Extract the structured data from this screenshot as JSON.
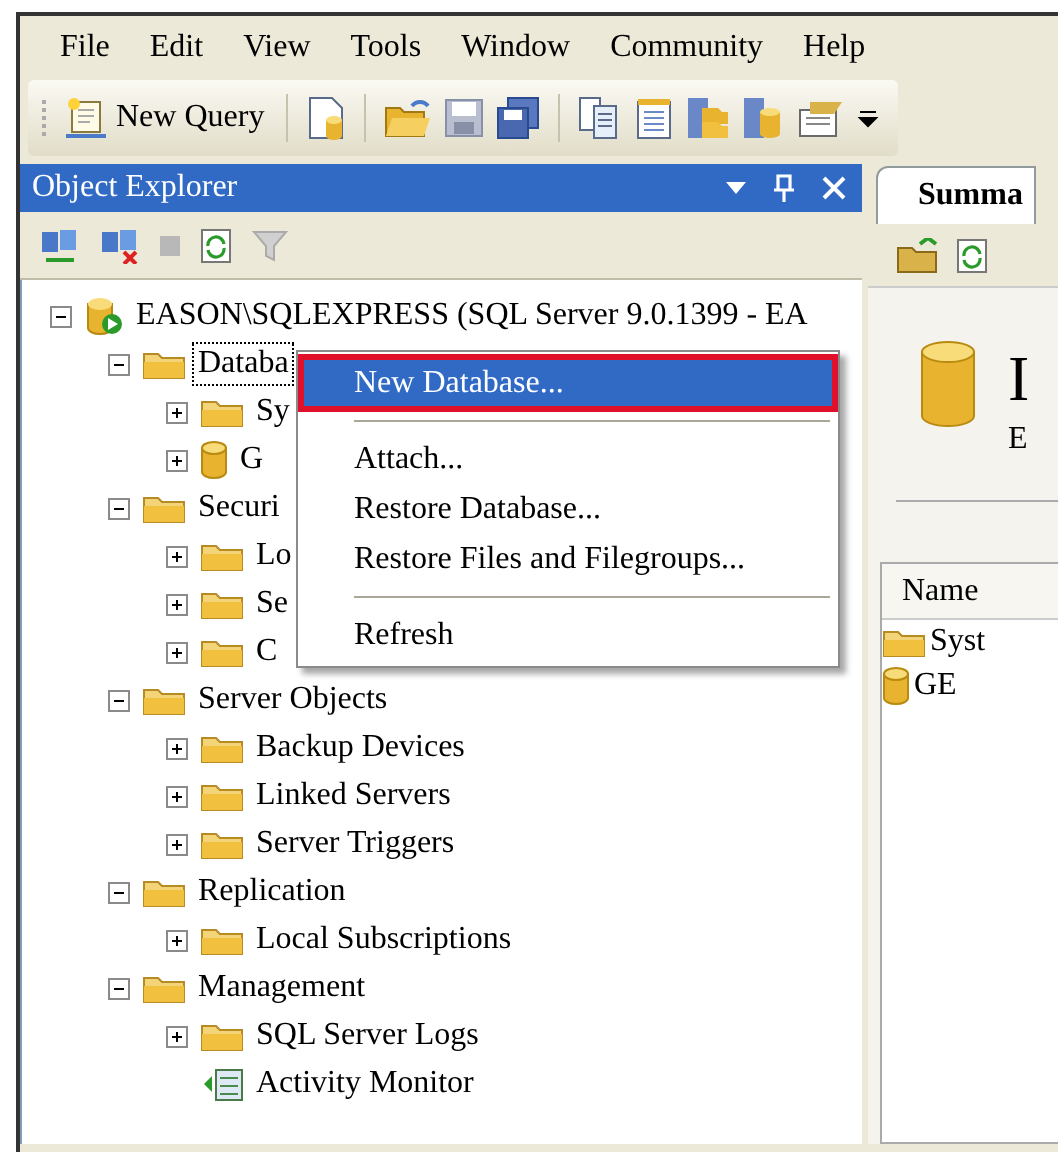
{
  "menu_bar": [
    "File",
    "Edit",
    "View",
    "Tools",
    "Window",
    "Community",
    "Help"
  ],
  "toolbar": {
    "new_query": "New Query"
  },
  "object_explorer": {
    "title": "Object Explorer",
    "tree": [
      {
        "label": "EASON\\SQLEXPRESS (SQL Server 9.0.1399 - EA",
        "kind": "server",
        "expanded": true,
        "selected": false,
        "children": [
          {
            "label": "Databa",
            "kind": "folder",
            "expanded": true,
            "selected": true,
            "children": [
              {
                "label": "Sy",
                "kind": "folder",
                "expanded": false,
                "selected": false
              },
              {
                "label": "G",
                "kind": "database",
                "expanded": false,
                "selected": false
              }
            ]
          },
          {
            "label": "Securi",
            "kind": "folder",
            "expanded": true,
            "selected": false,
            "children": [
              {
                "label": "Lo",
                "kind": "folder",
                "expanded": false,
                "selected": false
              },
              {
                "label": "Se",
                "kind": "folder",
                "expanded": false,
                "selected": false
              },
              {
                "label": "C",
                "kind": "folder",
                "expanded": false,
                "selected": false
              }
            ]
          },
          {
            "label": "Server Objects",
            "kind": "folder",
            "expanded": true,
            "selected": false,
            "children": [
              {
                "label": "Backup Devices",
                "kind": "folder",
                "expanded": false,
                "selected": false
              },
              {
                "label": "Linked Servers",
                "kind": "folder",
                "expanded": false,
                "selected": false
              },
              {
                "label": "Server Triggers",
                "kind": "folder",
                "expanded": false,
                "selected": false
              }
            ]
          },
          {
            "label": "Replication",
            "kind": "folder",
            "expanded": true,
            "selected": false,
            "children": [
              {
                "label": "Local Subscriptions",
                "kind": "folder",
                "expanded": false,
                "selected": false
              }
            ]
          },
          {
            "label": "Management",
            "kind": "folder",
            "expanded": true,
            "selected": false,
            "children": [
              {
                "label": "SQL Server Logs",
                "kind": "folder",
                "expanded": false,
                "selected": false
              },
              {
                "label": "Activity Monitor",
                "kind": "monitor",
                "selected": false
              }
            ]
          }
        ]
      }
    ]
  },
  "context_menu": {
    "items": [
      {
        "kind": "item",
        "label": "New Database...",
        "selected": true,
        "annotated": true
      },
      {
        "kind": "separator"
      },
      {
        "kind": "item",
        "label": "Attach...",
        "selected": false,
        "annotated": false
      },
      {
        "kind": "item",
        "label": "Restore Database...",
        "selected": false,
        "annotated": false
      },
      {
        "kind": "item",
        "label": "Restore Files and Filegroups...",
        "selected": false,
        "annotated": false
      },
      {
        "kind": "separator"
      },
      {
        "kind": "item",
        "label": "Refresh",
        "selected": false,
        "annotated": false
      }
    ]
  },
  "summary": {
    "tab": "Summa",
    "heading": "I",
    "subheading": "E",
    "list": {
      "columns": [
        "Name"
      ],
      "rows": [
        {
          "kind": "folder",
          "name": "Syst"
        },
        {
          "kind": "database",
          "name": "GE"
        }
      ]
    }
  }
}
